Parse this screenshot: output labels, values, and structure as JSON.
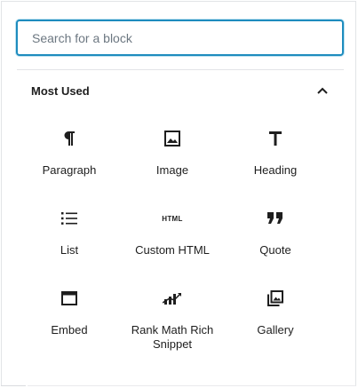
{
  "search": {
    "placeholder": "Search for a block",
    "value": ""
  },
  "panel": {
    "title": "Most Used",
    "expanded": true
  },
  "blocks": [
    {
      "label": "Paragraph",
      "icon": "paragraph-icon"
    },
    {
      "label": "Image",
      "icon": "image-icon"
    },
    {
      "label": "Heading",
      "icon": "heading-icon"
    },
    {
      "label": "List",
      "icon": "list-icon"
    },
    {
      "label": "Custom HTML",
      "icon": "html-icon",
      "icon_text": "HTML"
    },
    {
      "label": "Quote",
      "icon": "quote-icon"
    },
    {
      "label": "Embed",
      "icon": "embed-icon"
    },
    {
      "label": "Rank Math Rich Snippet",
      "icon": "rank-math-icon"
    },
    {
      "label": "Gallery",
      "icon": "gallery-icon"
    }
  ],
  "colors": {
    "accent": "#1e8cbe",
    "text": "#1e1e1e",
    "border": "#e2e4e7",
    "placeholder": "#6c7781"
  }
}
